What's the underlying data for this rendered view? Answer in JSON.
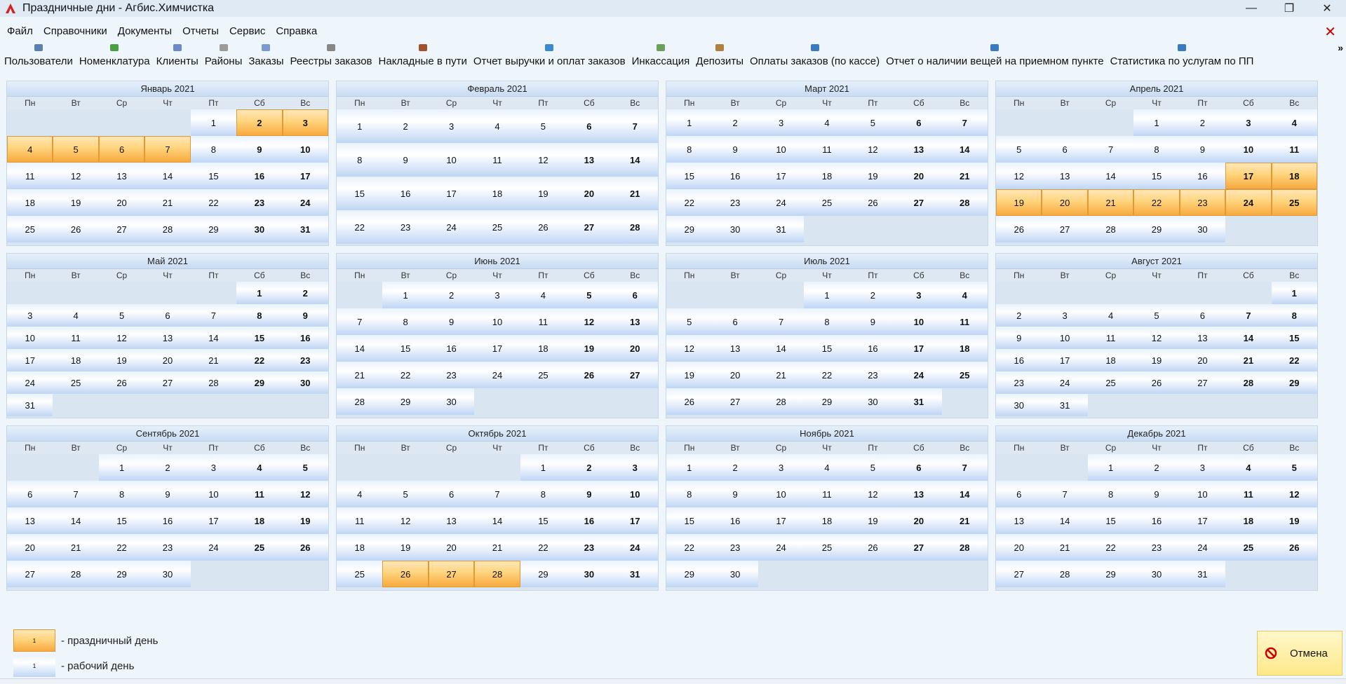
{
  "window": {
    "title": "Праздничные дни - Агбис.Химчистка",
    "minimize": "—",
    "restore": "❐",
    "close": "✕"
  },
  "menu": [
    "Файл",
    "Справочники",
    "Документы",
    "Отчеты",
    "Сервис",
    "Справка"
  ],
  "toolbar": [
    {
      "label": "Пользователи",
      "icon": "users-icon"
    },
    {
      "label": "Номенклатура",
      "icon": "nomenclature-icon"
    },
    {
      "label": "Клиенты",
      "icon": "clients-icon"
    },
    {
      "label": "Районы",
      "icon": "districts-icon"
    },
    {
      "label": "Заказы",
      "icon": "orders-icon"
    },
    {
      "label": "Реестры заказов",
      "icon": "registry-icon"
    },
    {
      "label": "Накладные в пути",
      "icon": "waybill-icon"
    },
    {
      "label": "Отчет выручки и оплат заказов",
      "icon": "revenue-report-icon"
    },
    {
      "label": "Инкассация",
      "icon": "collection-icon"
    },
    {
      "label": "Депозиты",
      "icon": "deposits-icon"
    },
    {
      "label": "Оплаты заказов (по кассе)",
      "icon": "payments-icon"
    },
    {
      "label": "Отчет о наличии вещей на приемном пункте",
      "icon": "items-report-icon"
    },
    {
      "label": "Статистика по услугам по ПП",
      "icon": "stats-icon"
    }
  ],
  "toolbar_more": "»",
  "weekdays": [
    "Пн",
    "Вт",
    "Ср",
    "Чт",
    "Пт",
    "Сб",
    "Вс"
  ],
  "months": [
    {
      "title": "Январь 2021",
      "first_weekday": 4,
      "days": 31,
      "holidays": [
        2,
        3,
        4,
        5,
        6,
        7
      ]
    },
    {
      "title": "Февраль 2021",
      "first_weekday": 0,
      "days": 28,
      "holidays": []
    },
    {
      "title": "Март 2021",
      "first_weekday": 0,
      "days": 31,
      "holidays": []
    },
    {
      "title": "Апрель 2021",
      "first_weekday": 3,
      "days": 30,
      "holidays": [
        17,
        18,
        19,
        20,
        21,
        22,
        23,
        24,
        25
      ]
    },
    {
      "title": "Май 2021",
      "first_weekday": 5,
      "days": 31,
      "holidays": []
    },
    {
      "title": "Июнь 2021",
      "first_weekday": 1,
      "days": 30,
      "holidays": []
    },
    {
      "title": "Июль 2021",
      "first_weekday": 3,
      "days": 31,
      "holidays": []
    },
    {
      "title": "Август 2021",
      "first_weekday": 6,
      "days": 31,
      "holidays": []
    },
    {
      "title": "Сентябрь 2021",
      "first_weekday": 2,
      "days": 30,
      "holidays": []
    },
    {
      "title": "Октябрь 2021",
      "first_weekday": 4,
      "days": 31,
      "holidays": [
        26,
        27,
        28
      ]
    },
    {
      "title": "Ноябрь 2021",
      "first_weekday": 0,
      "days": 30,
      "holidays": []
    },
    {
      "title": "Декабрь 2021",
      "first_weekday": 2,
      "days": 31,
      "holidays": []
    }
  ],
  "legend": {
    "holiday_sample": "1",
    "holiday_label": "- праздничный день",
    "work_sample": "1",
    "work_label": "- рабочий день"
  },
  "cancel_label": "Отмена",
  "colors": {
    "holiday": "#ffd47c",
    "work": "#bfd6f5",
    "background": "#eef6fc",
    "close_red": "#d00000"
  }
}
